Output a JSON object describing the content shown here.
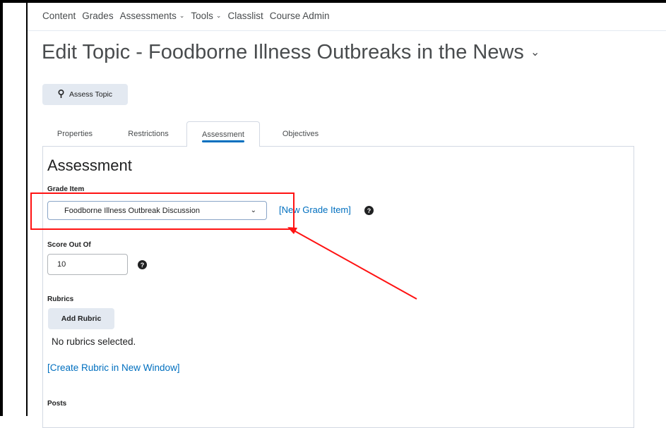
{
  "nav": {
    "items": [
      {
        "label": "Content",
        "has_chevron": false
      },
      {
        "label": "Grades",
        "has_chevron": false
      },
      {
        "label": "Assessments",
        "has_chevron": true
      },
      {
        "label": "Tools",
        "has_chevron": true
      },
      {
        "label": "Classlist",
        "has_chevron": false
      },
      {
        "label": "Course Admin",
        "has_chevron": false
      }
    ],
    "chevron_glyph": "⌄"
  },
  "page": {
    "title": "Edit Topic - Foodborne Illness Outbreaks in the News",
    "title_chevron": "⌄"
  },
  "actions": {
    "assess_topic": "Assess Topic",
    "pin_icon": "pin-icon"
  },
  "tabs": [
    {
      "label": "Properties",
      "active": false
    },
    {
      "label": "Restrictions",
      "active": false
    },
    {
      "label": "Assessment",
      "active": true
    },
    {
      "label": "Objectives",
      "active": false
    }
  ],
  "assessment": {
    "section_title": "Assessment",
    "grade_item": {
      "label": "Grade Item",
      "selected_value": "Foodborne Illness Outbreak Discussion",
      "new_link": "[New Grade Item]"
    },
    "score": {
      "label": "Score Out Of",
      "value": "10"
    },
    "rubrics": {
      "label": "Rubrics",
      "add_button": "Add Rubric",
      "empty_text": "No rubrics selected.",
      "create_link": "[Create Rubric in New Window]"
    },
    "posts_label": "Posts"
  },
  "help_glyph": "?",
  "colors": {
    "link": "#006fbf",
    "annotation": "#ff1212",
    "button_bg": "#e3e9f1",
    "active_tab_indicator": "#006fbf"
  }
}
